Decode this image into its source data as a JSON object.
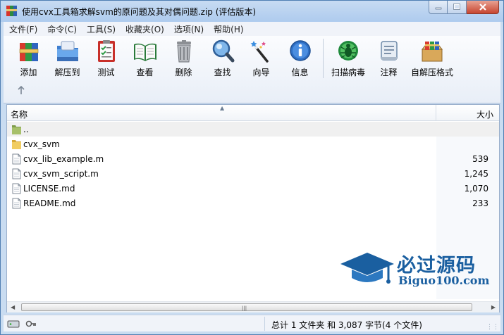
{
  "window": {
    "title": "使用cvx工具箱求解svm的原问题及其对偶问题.zip (评估版本)"
  },
  "menu": [
    "文件(F)",
    "命令(C)",
    "工具(S)",
    "收藏夹(O)",
    "选项(N)",
    "帮助(H)"
  ],
  "toolbar": {
    "buttons": [
      {
        "label": "添加",
        "icon": "add-archive-icon"
      },
      {
        "label": "解压到",
        "icon": "extract-folder-icon"
      },
      {
        "label": "测试",
        "icon": "test-checklist-icon"
      },
      {
        "label": "查看",
        "icon": "view-book-icon"
      },
      {
        "label": "删除",
        "icon": "trash-icon"
      },
      {
        "label": "查找",
        "icon": "magnifier-icon"
      },
      {
        "label": "向导",
        "icon": "wizard-wand-icon"
      },
      {
        "label": "信息",
        "icon": "info-icon"
      },
      {
        "label": "扫描病毒",
        "icon": "virus-scan-icon"
      },
      {
        "label": "注释",
        "icon": "comment-icon"
      },
      {
        "label": "自解压格式",
        "icon": "sfx-box-icon"
      }
    ]
  },
  "columns": {
    "name": "名称",
    "size": "大小"
  },
  "files": [
    {
      "name": "..",
      "size": "",
      "type": "parent-folder"
    },
    {
      "name": "cvx_svm",
      "size": "",
      "type": "folder"
    },
    {
      "name": "cvx_lib_example.m",
      "size": "539",
      "type": "file"
    },
    {
      "name": "cvx_svm_script.m",
      "size": "1,245",
      "type": "file"
    },
    {
      "name": "LICENSE.md",
      "size": "1,070",
      "type": "file"
    },
    {
      "name": "README.md",
      "size": "233",
      "type": "file"
    }
  ],
  "watermark": {
    "title": "必过源码",
    "subtitle": "Biguo100.com"
  },
  "status": {
    "text": "总计 1 文件夹 和 3,087 字节(4 个文件)"
  },
  "colors": {
    "accent": "#1a5fa0",
    "titlebar": "#aecbee",
    "close": "#c7452f"
  }
}
